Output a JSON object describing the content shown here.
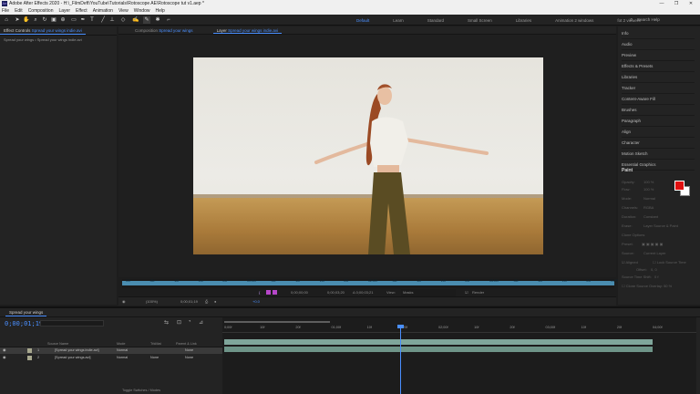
{
  "window": {
    "title": "Adobe After Effects 2020 - H:\\_FilmDeft\\YouTube\\Tutorials\\Rotoscope AE\\Rotoscope tut v1.aep *",
    "app_icon_label": "Ae",
    "controls": [
      "—",
      "❐",
      "✕"
    ]
  },
  "menu": [
    "File",
    "Edit",
    "Composition",
    "Layer",
    "Effect",
    "Animation",
    "View",
    "Window",
    "Help"
  ],
  "toolbar": {
    "workspaces": [
      "Default",
      "Learn",
      "Standard",
      "Small Screen",
      "Libraries",
      "Animation 2 windows",
      "fot 2 viewers"
    ],
    "active_workspace": "Default",
    "search_placeholder": "Search Help"
  },
  "left_panel": {
    "tab": "Effect Controls",
    "tab_target": "Spread your wings indie.avi",
    "breadcrumb": "Spread your wings • Spread your wings indie.avi"
  },
  "viewer": {
    "tabs": [
      {
        "label": "Composition",
        "target": "Spread your wings"
      },
      {
        "label": "Layer",
        "target": "Spread your wings indie.avi"
      }
    ],
    "active_tab": "Layer",
    "layer_ticks": [
      "00f",
      "05f",
      "10f",
      "15f",
      "20f",
      "01:00f",
      "05f",
      "10f",
      "15f",
      "20f",
      "02:00f",
      "05f",
      "10f",
      "15f",
      "20f",
      "03:00f",
      "05f",
      "10f",
      "15f",
      "20f",
      "04:00f"
    ],
    "layer_controls": {
      "start": "0;00;00;00",
      "end": "0;00;03;20",
      "duration": "Δ 0;00;03;21",
      "view_label": "View:",
      "view_value": "Masks",
      "render_label": "Render"
    },
    "footer": {
      "zoom": "(100%)",
      "timecode": "0;00;01;19",
      "offset": "+0.0"
    }
  },
  "right_panel": {
    "items": [
      "Info",
      "Audio",
      "Preview",
      "Effects & Presets",
      "Libraries",
      "Tracker",
      "Content-Aware Fill",
      "Brushes",
      "Paragraph",
      "Align",
      "Character",
      "Motion Sketch",
      "Essential Graphics"
    ],
    "paint": {
      "title": "Paint",
      "opacity_label": "Opacity:",
      "opacity_value": "100 %",
      "flow_label": "Flow:",
      "flow_value": "100 %",
      "mode_label": "Mode:",
      "mode_value": "Normal",
      "channels_label": "Channels:",
      "channels_value": "RGBA",
      "duration_label": "Duration:",
      "duration_value": "Constant",
      "erase_label": "Erase:",
      "erase_value": "Layer Source & Paint",
      "clone_options_label": "Clone Options",
      "preset_label": "Preset:",
      "source_label": "Source:",
      "source_value": "Current Layer",
      "aligned_label": "Aligned",
      "lock_label": "Lock Source Time",
      "offset_label": "Offset:",
      "offset_value": "0, 0",
      "source_time_label": "Source Time Shift:",
      "source_time_value": "0 f",
      "overlay_label": "Clone Source Overlay:",
      "overlay_value": "50 %",
      "fg_color": "#e01010",
      "bg_color": "#ffffff"
    }
  },
  "timeline": {
    "tab": "Spread your wings",
    "timecode": "0;00;01;19",
    "columns": {
      "source": "Source Name",
      "mode": "Mode",
      "trkmat": "TrkMat",
      "parent": "Parent & Link"
    },
    "layers": [
      {
        "num": "1",
        "name": "[Spread your wings indie.avi]",
        "mode": "Normal",
        "trkmat": "",
        "parent": "None"
      },
      {
        "num": "2",
        "name": "[Spread your wings.avi]",
        "mode": "Normal",
        "trkmat": "None",
        "parent": "None"
      }
    ],
    "ruler": [
      "0;00f",
      "10f",
      "20f",
      "01;00f",
      "10f",
      "20f",
      "02;00f",
      "10f",
      "20f",
      "03;00f",
      "10f",
      "20f",
      "04;00f"
    ],
    "toggle_label": "Toggle Switches / Modes"
  }
}
